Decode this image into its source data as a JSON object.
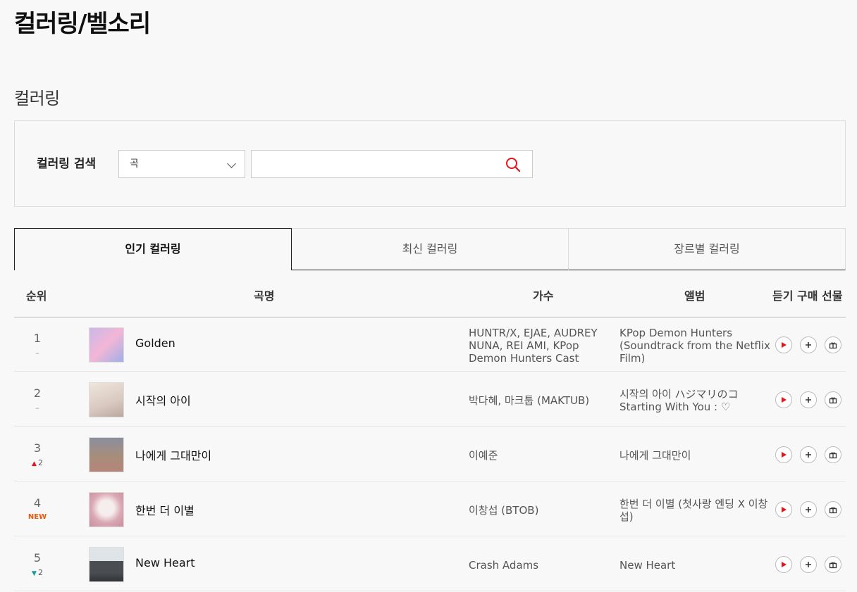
{
  "page": {
    "title": "컬러링/벨소리",
    "section_title": "컬러링"
  },
  "search": {
    "label": "컬러링 검색",
    "select_value": "곡",
    "input_value": "",
    "input_placeholder": ""
  },
  "tabs": [
    {
      "label": "인기 컬러링",
      "active": true
    },
    {
      "label": "최신 컬러링",
      "active": false
    },
    {
      "label": "장르별 컬러링",
      "active": false
    }
  ],
  "table": {
    "headers": {
      "rank": "순위",
      "title": "곡명",
      "artist": "가수",
      "album": "앨범",
      "listen": "듣기",
      "buy": "구매",
      "gift": "선물"
    },
    "rows": [
      {
        "rank": "1",
        "change": "–",
        "change_type": "same",
        "title": "Golden",
        "artist": "HUNTR/X, EJAE, AUDREY NUNA, REI AMI, KPop Demon Hunters Cast",
        "album": "KPop Demon Hunters (Soundtrack from the Netflix Film)"
      },
      {
        "rank": "2",
        "change": "–",
        "change_type": "same",
        "title": "시작의 아이",
        "artist": "박다혜, 마크툽 (MAKTUB)",
        "album": "시작의 아이 ハジマリのコ Starting With You : ♡"
      },
      {
        "rank": "3",
        "change": "2",
        "change_type": "up",
        "title": "나에게 그대만이",
        "artist": "이예준",
        "album": "나에게 그대만이"
      },
      {
        "rank": "4",
        "change": "NEW",
        "change_type": "new",
        "title": "한번 더 이별",
        "artist": "이창섭 (BTOB)",
        "album": "한번 더 이별 (첫사랑 엔딩 X 이창섭)"
      },
      {
        "rank": "5",
        "change": "2",
        "change_type": "down",
        "title": "New Heart",
        "artist": "Crash Adams",
        "album": "New Heart"
      }
    ]
  },
  "colors": {
    "accent": "#e0161e",
    "up": "#e0161e",
    "down": "#109ca2",
    "new": "#e8590c"
  }
}
